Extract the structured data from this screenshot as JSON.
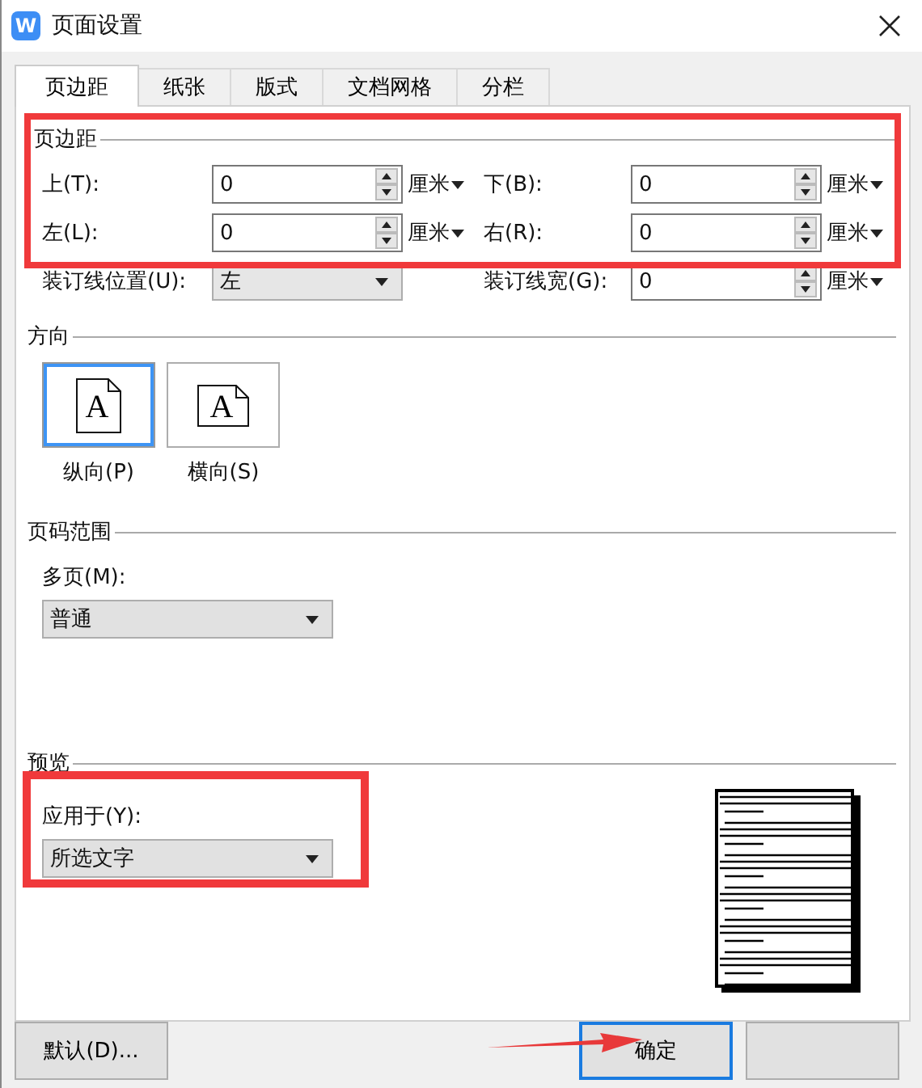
{
  "window": {
    "logo": "W",
    "title": "页面设置"
  },
  "tabs": [
    {
      "label": "页边距",
      "selected": true
    },
    {
      "label": "纸张",
      "selected": false
    },
    {
      "label": "版式",
      "selected": false
    },
    {
      "label": "文档网格",
      "selected": false
    },
    {
      "label": "分栏",
      "selected": false
    }
  ],
  "margins": {
    "title": "页边距",
    "highlighted": true,
    "fields": [
      {
        "label": "上(T):",
        "value": "0",
        "unit": "厘米"
      },
      {
        "label": "下(B):",
        "value": "0",
        "unit": "厘米"
      },
      {
        "label": "左(L):",
        "value": "0",
        "unit": "厘米"
      },
      {
        "label": "右(R):",
        "value": "0",
        "unit": "厘米"
      }
    ]
  },
  "gutter": {
    "position_label": "装订线位置(U):",
    "position_value": "左",
    "width_label": "装订线宽(G):",
    "width_value": "0",
    "width_unit": "厘米"
  },
  "orientation": {
    "title": "方向",
    "options": [
      {
        "label": "纵向(P)",
        "glyph": "A",
        "kind": "portrait",
        "selected": true
      },
      {
        "label": "横向(S)",
        "glyph": "A",
        "kind": "landscape",
        "selected": false
      }
    ]
  },
  "page_range": {
    "title": "页码范围",
    "label": "多页(M):",
    "value": "普通"
  },
  "preview": {
    "title": "预览",
    "label": "应用于(Y):",
    "value": "所选文字",
    "highlighted": true
  },
  "buttons": [
    {
      "label": "默认(D)...",
      "focused": false,
      "pointed": false
    },
    {
      "label": "确定",
      "focused": true,
      "pointed": true
    },
    {
      "focused": false,
      "pointed": false
    }
  ]
}
